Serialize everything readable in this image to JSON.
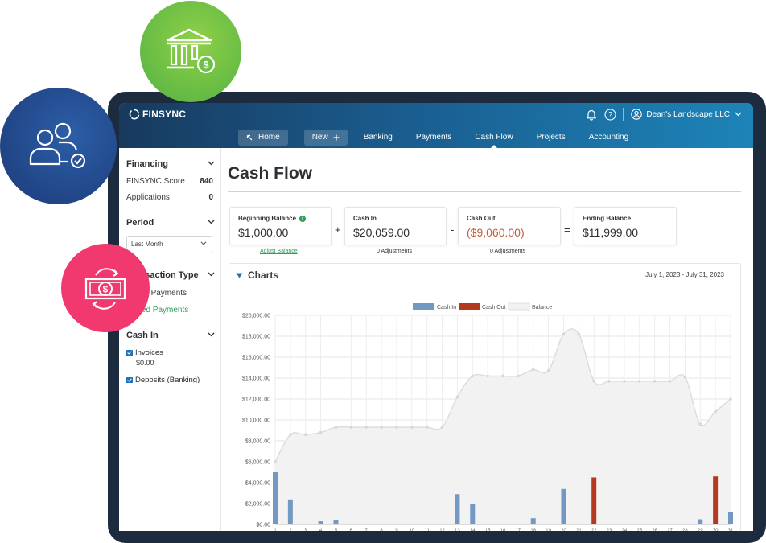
{
  "app": {
    "brand": "FINSYNC",
    "company": "Dean's Landscape LLC",
    "icons": {
      "bell": "bell-icon",
      "help": "help-icon",
      "account": "user-circle-icon"
    }
  },
  "nav": {
    "home": "Home",
    "new": "New",
    "items": [
      "Banking",
      "Payments",
      "Cash Flow",
      "Projects",
      "Accounting"
    ],
    "active": "Cash Flow"
  },
  "sidebar": {
    "financing": {
      "title": "Financing",
      "score_label": "FINSYNC Score",
      "score_value": "840",
      "applications_label": "Applications",
      "applications_value": "0"
    },
    "period": {
      "title": "Period",
      "selected": "Last Month"
    },
    "transaction_type": {
      "title": "Transaction Type",
      "visible_title": "ction Type",
      "estimated": "mated Payments",
      "scheduled": "eduled Payments"
    },
    "cash_in": {
      "title": "Cash In",
      "invoices_label": "Invoices",
      "invoices_value": "$0.00",
      "deposits_label": "Deposits (Banking)"
    }
  },
  "page": {
    "title": "Cash Flow"
  },
  "summary": {
    "beginning": {
      "label": "Beginning Balance",
      "value": "$1,000.00",
      "link": "Adjust Balance"
    },
    "plus": "+",
    "cash_in": {
      "label": "Cash In",
      "value": "$20,059.00",
      "sub": "0 Adjustments"
    },
    "minus": "-",
    "cash_out": {
      "label": "Cash Out",
      "value": "($9,060.00)",
      "sub": "0 Adjustments"
    },
    "equals": "=",
    "ending": {
      "label": "Ending Balance",
      "value": "$11,999.00"
    }
  },
  "charts": {
    "title": "Charts",
    "date_range": "July 1, 2023 - July 31, 2023"
  },
  "chart_data": {
    "type": "bar",
    "legend": [
      "Cash In",
      "Cash Out",
      "Balance"
    ],
    "legend_position": "top-center",
    "grid": true,
    "colors": {
      "cash_in": "#7398c2",
      "cash_out": "#b33a1e",
      "balance_fill": "#f2f2f2",
      "balance_line": "#dcdcdc"
    },
    "y_ticks": [
      "$0.00",
      "$2,000.00",
      "$4,000.00",
      "$6,000.00",
      "$8,000.00",
      "$10,000.00",
      "$12,000.00",
      "$14,000.00",
      "$16,000.00",
      "$18,000.00",
      "$20,000.00"
    ],
    "ylim": [
      0,
      20000
    ],
    "x": [
      1,
      2,
      3,
      4,
      5,
      6,
      7,
      8,
      9,
      10,
      11,
      12,
      13,
      14,
      15,
      16,
      17,
      18,
      19,
      20,
      21,
      22,
      23,
      24,
      25,
      26,
      27,
      28,
      29,
      30,
      31
    ],
    "series": [
      {
        "name": "Cash In",
        "values": [
          5000,
          2400,
          0,
          300,
          400,
          0,
          0,
          0,
          0,
          0,
          0,
          0,
          2900,
          2000,
          0,
          0,
          0,
          600,
          0,
          3400,
          0,
          0,
          0,
          0,
          0,
          0,
          0,
          0,
          500,
          0,
          1200
        ]
      },
      {
        "name": "Cash Out",
        "values": [
          0,
          0,
          0,
          0,
          0,
          0,
          0,
          0,
          0,
          0,
          0,
          0,
          0,
          0,
          0,
          0,
          0,
          0,
          0,
          0,
          0,
          4500,
          0,
          0,
          0,
          0,
          0,
          0,
          0,
          4600,
          0
        ]
      },
      {
        "name": "Balance",
        "values": [
          6000,
          8600,
          8600,
          8800,
          9300,
          9300,
          9300,
          9300,
          9300,
          9300,
          9300,
          9300,
          12200,
          14200,
          14200,
          14200,
          14200,
          14800,
          14700,
          18200,
          18200,
          13700,
          13700,
          13700,
          13700,
          13700,
          13700,
          14100,
          9600,
          10800,
          12000
        ]
      }
    ]
  }
}
